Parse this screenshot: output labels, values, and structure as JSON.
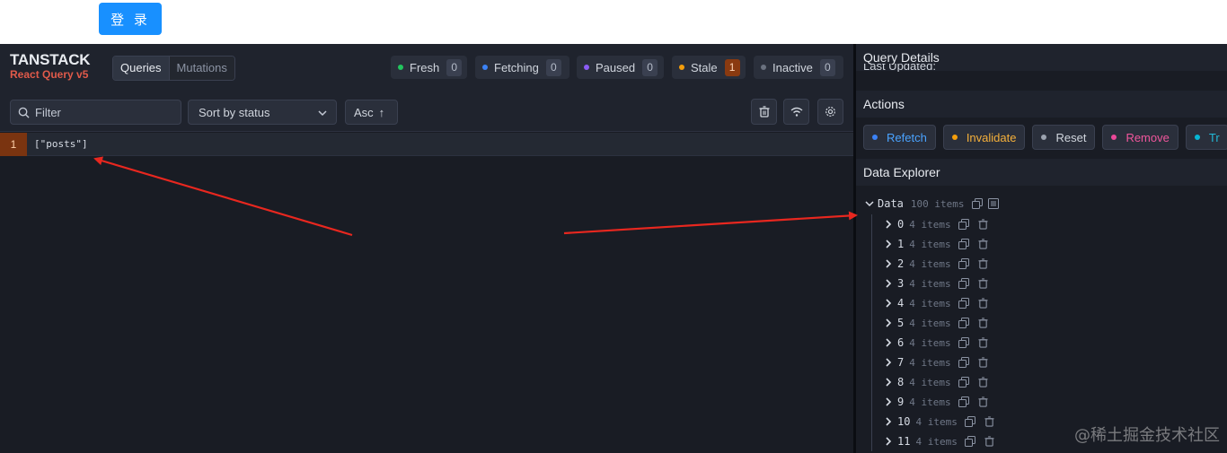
{
  "page": {
    "login_button": "登 录"
  },
  "devtools": {
    "logo_title": "TANSTACK",
    "logo_sub": "React Query v5",
    "tabs": [
      {
        "label": "Queries",
        "active": true
      },
      {
        "label": "Mutations",
        "active": false
      }
    ],
    "statuses": [
      {
        "label": "Fresh",
        "count": "0",
        "color": "#22c55e"
      },
      {
        "label": "Fetching",
        "count": "0",
        "color": "#3b82f6"
      },
      {
        "label": "Paused",
        "count": "0",
        "color": "#8b5cf6"
      },
      {
        "label": "Stale",
        "count": "1",
        "color": "#f59e0b"
      },
      {
        "label": "Inactive",
        "count": "0",
        "color": "#6b7280"
      }
    ],
    "filter_placeholder": "Filter",
    "sort_value": "Sort by status",
    "order_value": "Asc",
    "queries": [
      {
        "count": "1",
        "key": "[\"posts\"]"
      }
    ]
  },
  "details": {
    "query_details_title": "Query Details",
    "last_updated_label": "Last Updated:",
    "actions_title": "Actions",
    "actions": [
      {
        "label": "Refetch",
        "color": "#3b82f6"
      },
      {
        "label": "Invalidate",
        "color": "#f59e0b"
      },
      {
        "label": "Reset",
        "color": "#9ca3af"
      },
      {
        "label": "Remove",
        "color": "#ec4899"
      },
      {
        "label": "Tr",
        "color": "#06b6d4"
      }
    ],
    "data_explorer_title": "Data Explorer",
    "data_label": "Data",
    "data_meta": "100 items",
    "children": [
      {
        "label": "0",
        "meta": "4 items"
      },
      {
        "label": "1",
        "meta": "4 items"
      },
      {
        "label": "2",
        "meta": "4 items"
      },
      {
        "label": "3",
        "meta": "4 items"
      },
      {
        "label": "4",
        "meta": "4 items"
      },
      {
        "label": "5",
        "meta": "4 items"
      },
      {
        "label": "6",
        "meta": "4 items"
      },
      {
        "label": "7",
        "meta": "4 items"
      },
      {
        "label": "8",
        "meta": "4 items"
      },
      {
        "label": "9",
        "meta": "4 items"
      },
      {
        "label": "10",
        "meta": "4 items"
      },
      {
        "label": "11",
        "meta": "4 items"
      }
    ]
  },
  "watermark": "@稀土掘金技术社区"
}
